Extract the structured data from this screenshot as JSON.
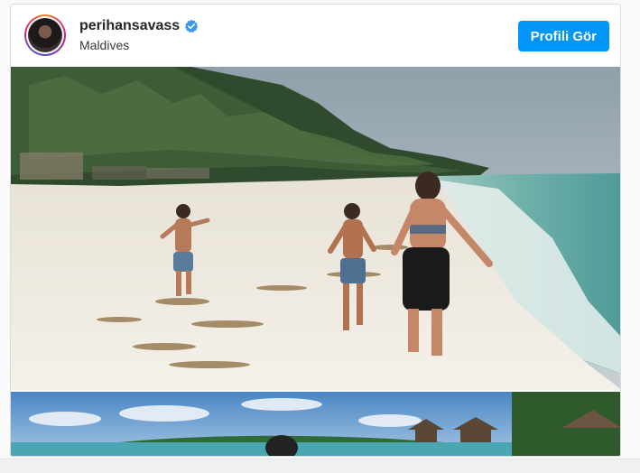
{
  "post": {
    "username": "perihansavass",
    "verified_icon": "verified-badge-icon",
    "location": "Maldives",
    "profile_button_label": "Profili Gör",
    "accent_color": "#0095f6"
  },
  "media": {
    "images": [
      {
        "name": "beach-photo",
        "depicts": "photo"
      },
      {
        "name": "resort-photo",
        "depicts": "photo"
      }
    ]
  }
}
